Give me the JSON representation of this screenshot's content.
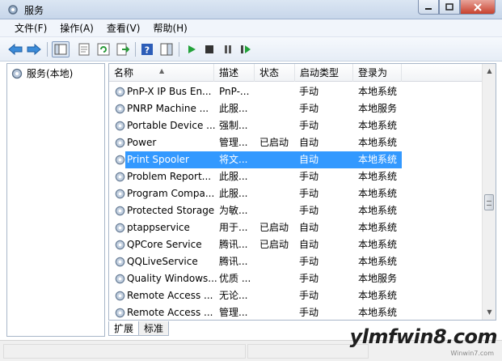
{
  "window": {
    "title": "服务"
  },
  "menu": [
    {
      "label": "文件(F)"
    },
    {
      "label": "操作(A)"
    },
    {
      "label": "查看(V)"
    },
    {
      "label": "帮助(H)"
    }
  ],
  "toolbar": {
    "buttons": [
      "back-arrow-icon",
      "forward-arrow-icon",
      "show-hide-tree-icon",
      "properties-icon",
      "refresh-icon",
      "export-list-icon",
      "help-icon",
      "action-pane-icon",
      "start-service-icon",
      "stop-service-icon",
      "pause-service-icon",
      "restart-service-icon"
    ]
  },
  "tree": {
    "root_label": "服务(本地)"
  },
  "table": {
    "columns": [
      "名称",
      "描述",
      "状态",
      "启动类型",
      "登录为"
    ],
    "rows": [
      {
        "name": "PnP-X IP Bus En...",
        "desc": "PnP-...",
        "status": "",
        "startup": "手动",
        "logon": "本地系统",
        "selected": false
      },
      {
        "name": "PNRP Machine ...",
        "desc": "此服...",
        "status": "",
        "startup": "手动",
        "logon": "本地服务",
        "selected": false
      },
      {
        "name": "Portable Device ...",
        "desc": "强制...",
        "status": "",
        "startup": "手动",
        "logon": "本地系统",
        "selected": false
      },
      {
        "name": "Power",
        "desc": "管理...",
        "status": "已启动",
        "startup": "自动",
        "logon": "本地系统",
        "selected": false
      },
      {
        "name": "Print Spooler",
        "desc": "将文...",
        "status": "",
        "startup": "自动",
        "logon": "本地系统",
        "selected": true
      },
      {
        "name": "Problem Report...",
        "desc": "此服...",
        "status": "",
        "startup": "手动",
        "logon": "本地系统",
        "selected": false
      },
      {
        "name": "Program Compa...",
        "desc": "此服...",
        "status": "",
        "startup": "手动",
        "logon": "本地系统",
        "selected": false
      },
      {
        "name": "Protected Storage",
        "desc": "为敏...",
        "status": "",
        "startup": "手动",
        "logon": "本地系统",
        "selected": false
      },
      {
        "name": "ptappservice",
        "desc": "用于...",
        "status": "已启动",
        "startup": "自动",
        "logon": "本地系统",
        "selected": false
      },
      {
        "name": "QPCore Service",
        "desc": "腾讯...",
        "status": "已启动",
        "startup": "自动",
        "logon": "本地系统",
        "selected": false
      },
      {
        "name": "QQLiveService",
        "desc": "腾讯...",
        "status": "",
        "startup": "手动",
        "logon": "本地系统",
        "selected": false
      },
      {
        "name": "Quality Windows...",
        "desc": "优质 ...",
        "status": "",
        "startup": "手动",
        "logon": "本地服务",
        "selected": false
      },
      {
        "name": "Remote Access ...",
        "desc": "无论...",
        "status": "",
        "startup": "手动",
        "logon": "本地系统",
        "selected": false
      },
      {
        "name": "Remote Access ...",
        "desc": "管理...",
        "status": "",
        "startup": "手动",
        "logon": "本地系统",
        "selected": false
      }
    ]
  },
  "tabs": [
    {
      "label": "扩展"
    },
    {
      "label": "标准"
    }
  ],
  "watermark": {
    "text": "ylmfwin8.com",
    "sub": "Winwin7.com"
  },
  "colors": {
    "selection": "#3399ff",
    "accent": "#1f6fd0"
  }
}
